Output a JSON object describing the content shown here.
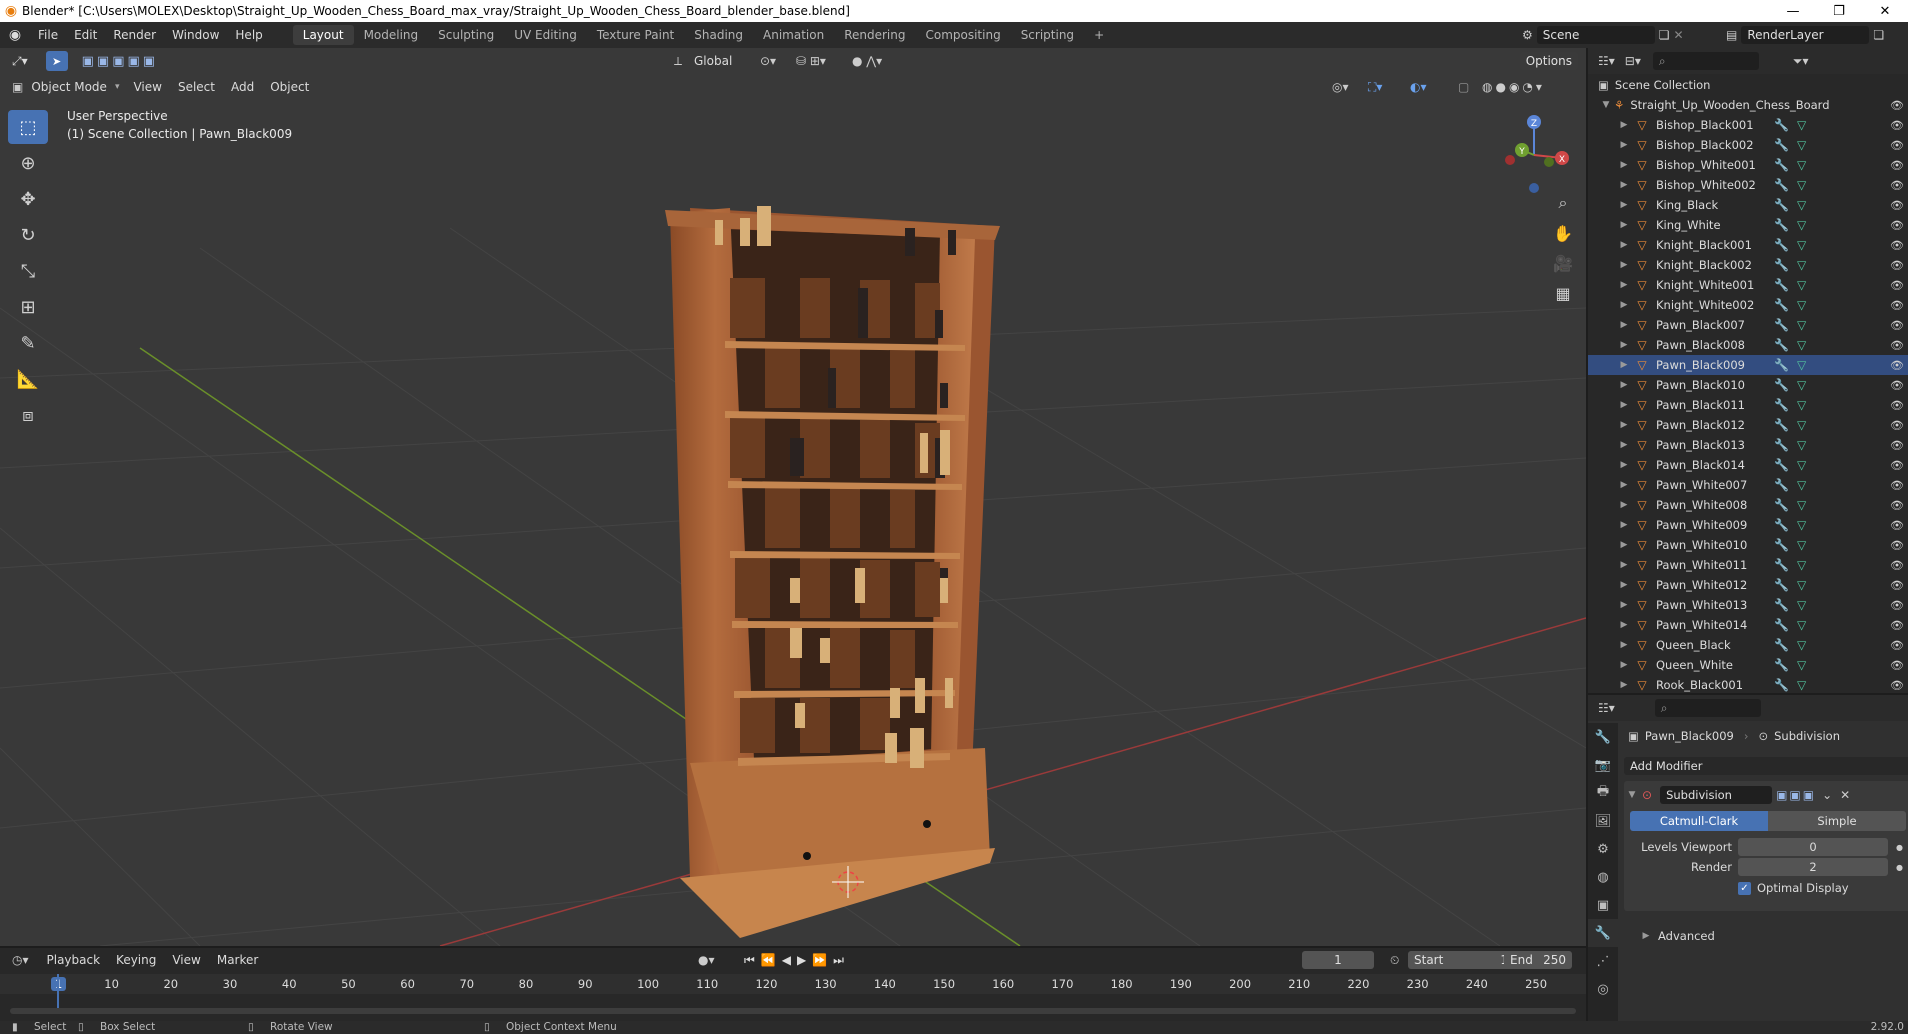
{
  "window": {
    "title": "Blender* [C:\\Users\\MOLEX\\Desktop\\Straight_Up_Wooden_Chess_Board_max_vray/Straight_Up_Wooden_Chess_Board_blender_base.blend]",
    "minimize": "—",
    "maximize": "❐",
    "close": "✕"
  },
  "menu": [
    "File",
    "Edit",
    "Render",
    "Window",
    "Help"
  ],
  "workspaces": [
    "Layout",
    "Modeling",
    "Sculpting",
    "UV Editing",
    "Texture Paint",
    "Shading",
    "Animation",
    "Rendering",
    "Compositing",
    "Scripting"
  ],
  "workspace_add": "+",
  "scene": {
    "name": "Scene",
    "view_layer": "RenderLayer"
  },
  "viewport": {
    "transform_orientation": "Global",
    "options_label": "Options",
    "mode": "Object Mode",
    "header_menus": [
      "View",
      "Select",
      "Add",
      "Object"
    ],
    "perspective_label": "User Perspective",
    "collection_label": "(1) Scene Collection | Pawn_Black009",
    "gizmo_axes": {
      "x": "X",
      "y": "Y",
      "z": "Z"
    }
  },
  "tools": [
    "select-box",
    "cursor",
    "move",
    "rotate",
    "scale",
    "transform",
    "annotate",
    "measure",
    "add-cube"
  ],
  "outliner": {
    "root": "Scene Collection",
    "collection": "Straight_Up_Wooden_Chess_Board",
    "items": [
      {
        "name": "Bishop_Black001",
        "selected": false
      },
      {
        "name": "Bishop_Black002",
        "selected": false
      },
      {
        "name": "Bishop_White001",
        "selected": false
      },
      {
        "name": "Bishop_White002",
        "selected": false
      },
      {
        "name": "King_Black",
        "selected": false
      },
      {
        "name": "King_White",
        "selected": false
      },
      {
        "name": "Knight_Black001",
        "selected": false
      },
      {
        "name": "Knight_Black002",
        "selected": false
      },
      {
        "name": "Knight_White001",
        "selected": false
      },
      {
        "name": "Knight_White002",
        "selected": false
      },
      {
        "name": "Pawn_Black007",
        "selected": false
      },
      {
        "name": "Pawn_Black008",
        "selected": false
      },
      {
        "name": "Pawn_Black009",
        "selected": true
      },
      {
        "name": "Pawn_Black010",
        "selected": false
      },
      {
        "name": "Pawn_Black011",
        "selected": false
      },
      {
        "name": "Pawn_Black012",
        "selected": false
      },
      {
        "name": "Pawn_Black013",
        "selected": false
      },
      {
        "name": "Pawn_Black014",
        "selected": false
      },
      {
        "name": "Pawn_White007",
        "selected": false
      },
      {
        "name": "Pawn_White008",
        "selected": false
      },
      {
        "name": "Pawn_White009",
        "selected": false
      },
      {
        "name": "Pawn_White010",
        "selected": false
      },
      {
        "name": "Pawn_White011",
        "selected": false
      },
      {
        "name": "Pawn_White012",
        "selected": false
      },
      {
        "name": "Pawn_White013",
        "selected": false
      },
      {
        "name": "Pawn_White014",
        "selected": false
      },
      {
        "name": "Queen_Black",
        "selected": false
      },
      {
        "name": "Queen_White",
        "selected": false
      },
      {
        "name": "Rook_Black001",
        "selected": false
      }
    ]
  },
  "properties": {
    "object_name": "Pawn_Black009",
    "modifier_crumb": "Subdivision",
    "add_modifier": "Add Modifier",
    "modifier": {
      "name": "Subdivision",
      "method_catmull": "Catmull-Clark",
      "method_simple": "Simple",
      "levels_viewport_label": "Levels Viewport",
      "levels_viewport": "0",
      "render_label": "Render",
      "render": "2",
      "optimal_display_label": "Optimal Display",
      "optimal_display": true,
      "advanced_label": "Advanced"
    }
  },
  "timeline": {
    "menus": [
      "Playback",
      "Keying",
      "View",
      "Marker"
    ],
    "current_frame": "1",
    "start_label": "Start",
    "start": "1",
    "end_label": "End",
    "end": "250",
    "ticks": [
      "1",
      "10",
      "20",
      "30",
      "40",
      "50",
      "60",
      "70",
      "80",
      "90",
      "100",
      "110",
      "120",
      "130",
      "140",
      "150",
      "160",
      "170",
      "180",
      "190",
      "200",
      "210",
      "220",
      "230",
      "240",
      "250"
    ]
  },
  "status": {
    "select": "Select",
    "box_select": "Box Select",
    "rotate_view": "Rotate View",
    "context_menu": "Object Context Menu",
    "version": "2.92.0"
  },
  "colors": {
    "accent": "#4772b3",
    "selection": "#334d80",
    "object_icon": "#e88a3a",
    "mesh_icon": "#52c19c",
    "wood_light": "#b06a3c",
    "wood_dark": "#7a4424"
  }
}
